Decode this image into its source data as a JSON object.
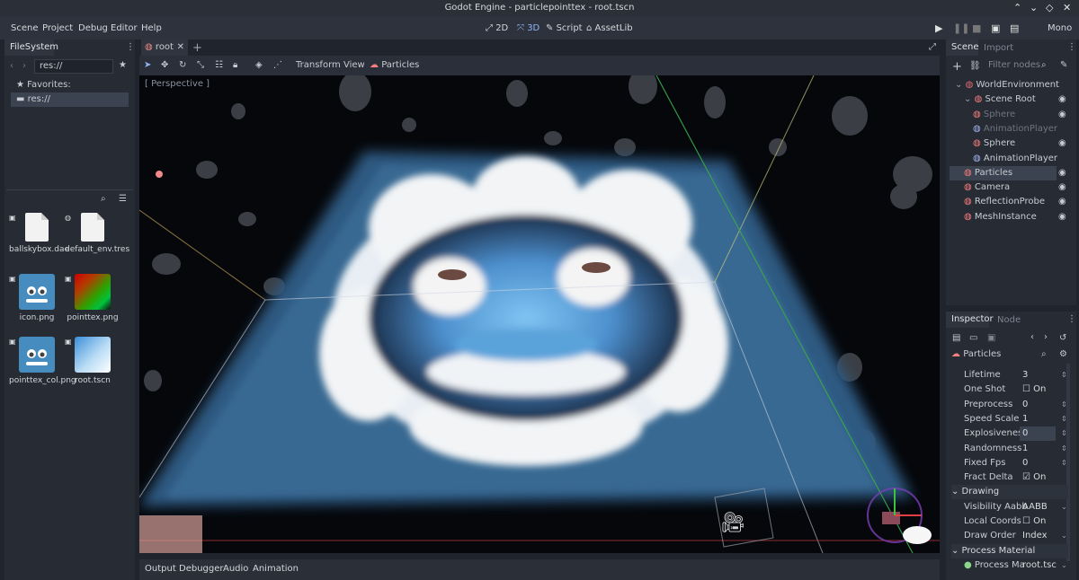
{
  "title_bar": {
    "text": "Godot Engine - particlepointtex - root.tscn",
    "buttons": [
      "⌃",
      "⌄",
      "◇",
      "✕"
    ]
  },
  "menu": {
    "items": [
      "Scene",
      "Project",
      "Debug",
      "Editor",
      "Help"
    ],
    "modes": [
      {
        "label": "2D",
        "icon": "2d-icon"
      },
      {
        "label": "3D",
        "icon": "3d-icon"
      },
      {
        "label": "Script",
        "icon": "script-icon"
      },
      {
        "label": "AssetLib",
        "icon": "assetlib-icon"
      }
    ],
    "run_buttons": [
      "▶",
      "❚❚",
      "■",
      "▣",
      "▤"
    ],
    "mono": "Mono"
  },
  "filesystem": {
    "tab": "FileSystem",
    "path": "res://",
    "favorites": "Favorites:",
    "root": "res://",
    "files": [
      {
        "name": "ballskybox.dae",
        "kind": "doc"
      },
      {
        "name": "default_env.tres",
        "kind": "doc"
      },
      {
        "name": "icon.png",
        "kind": "godot"
      },
      {
        "name": "pointtex.png",
        "kind": "gradient"
      },
      {
        "name": "pointtex_col.png",
        "kind": "godot"
      },
      {
        "name": "root.tscn",
        "kind": "scene"
      }
    ]
  },
  "editor_tabs": {
    "scene_tab": "root",
    "close": "✕",
    "add": "+"
  },
  "viewport_toolbar": {
    "menus": [
      "Transform",
      "View",
      "Particles"
    ],
    "perspective_label": "[ Perspective ]"
  },
  "scene_panel": {
    "tabs": [
      "Scene",
      "Import"
    ],
    "filter_placeholder": "Filter nodes",
    "nodes": [
      {
        "name": "WorldEnvironment",
        "color": "#e06c75",
        "depth": 0,
        "selected": false,
        "eye": false
      },
      {
        "name": "Scene Root",
        "color": "#fc7f7f",
        "depth": 1,
        "selected": false,
        "eye": true
      },
      {
        "name": "Sphere",
        "color": "#fc7f7f",
        "depth": 2,
        "selected": false,
        "eye": true,
        "dim": true
      },
      {
        "name": "AnimationPlayer",
        "color": "#a5b7f3",
        "depth": 2,
        "selected": false,
        "eye": false,
        "dim": true
      },
      {
        "name": "Sphere",
        "color": "#fc7f7f",
        "depth": 2,
        "selected": false,
        "eye": true
      },
      {
        "name": "AnimationPlayer",
        "color": "#a5b7f3",
        "depth": 2,
        "selected": false,
        "eye": false
      },
      {
        "name": "Particles",
        "color": "#fc7f7f",
        "depth": 1,
        "selected": true,
        "eye": true
      },
      {
        "name": "Camera",
        "color": "#fc7f7f",
        "depth": 1,
        "selected": false,
        "eye": true
      },
      {
        "name": "ReflectionProbe",
        "color": "#fc7f7f",
        "depth": 1,
        "selected": false,
        "eye": true
      },
      {
        "name": "MeshInstance",
        "color": "#fc7f7f",
        "depth": 1,
        "selected": false,
        "eye": true
      }
    ]
  },
  "inspector": {
    "tabs": [
      "Inspector",
      "Node"
    ],
    "object": "Particles",
    "props": [
      {
        "key": "Lifetime",
        "value": "3"
      },
      {
        "key": "One Shot",
        "value": "On",
        "check": true,
        "checked": false
      },
      {
        "key": "Preprocess",
        "value": "0"
      },
      {
        "key": "Speed Scale",
        "value": "1"
      },
      {
        "key": "Explosiveness",
        "value": "0",
        "highlight": true
      },
      {
        "key": "Randomness",
        "value": "1"
      },
      {
        "key": "Fixed Fps",
        "value": "0"
      },
      {
        "key": "Fract Delta",
        "value": "On",
        "check": true,
        "checked": true
      }
    ],
    "section_drawing": "Drawing",
    "drawing_props": [
      {
        "key": "Visibility Aabb",
        "value": "AABB"
      },
      {
        "key": "Local Coords",
        "value": "On",
        "check": true,
        "checked": false
      },
      {
        "key": "Draw Order",
        "value": "Index"
      }
    ],
    "section_process": "Process Material",
    "process_material": {
      "key": "Process Ma",
      "value": "root.tsc"
    }
  },
  "bottom_tabs": [
    "Output",
    "Debugger",
    "Audio",
    "Animation"
  ],
  "colors": {
    "accent": "#8fb6f2",
    "panel": "#262b34",
    "background": "#20242d"
  }
}
